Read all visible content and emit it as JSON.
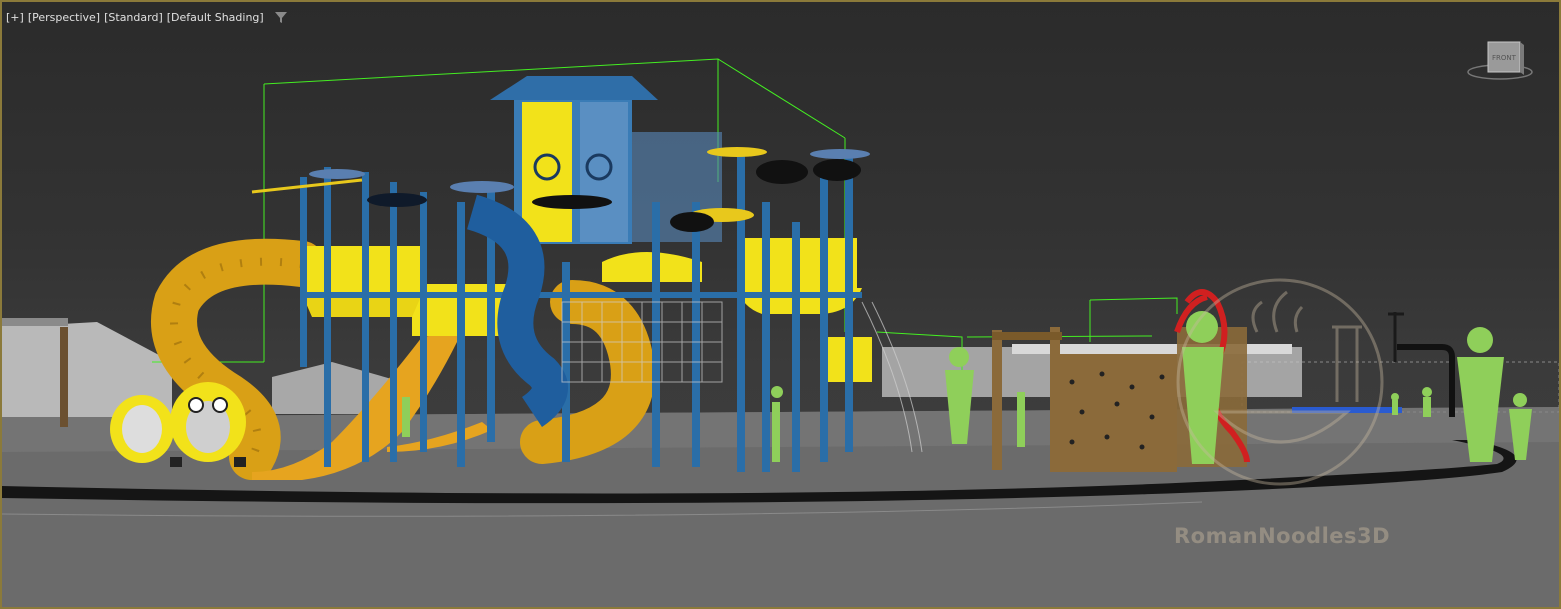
{
  "viewport": {
    "label_items": [
      {
        "name": "viewport-general-menu",
        "text": "[+]"
      },
      {
        "name": "viewport-point-of-view-menu",
        "text": "[Perspective]"
      },
      {
        "name": "viewport-camera-menu",
        "text": "[Standard]"
      },
      {
        "name": "viewport-shading-menu",
        "text": "[Default Shading]"
      }
    ],
    "filter_icon": "filter-icon",
    "viewcube_face": "FRONT"
  },
  "watermark": {
    "text": "RomanNoodles3D"
  },
  "colors": {
    "accent_border": "#8b7a3a",
    "selection_bbox": "#44ee22",
    "playground_blue": "#2a6ea8",
    "playground_yellow": "#f2e21a",
    "slide_orange": "#e0a21c",
    "figure_green": "#8fcf5a",
    "ground": "#6a6a6a",
    "track": "#161616"
  }
}
